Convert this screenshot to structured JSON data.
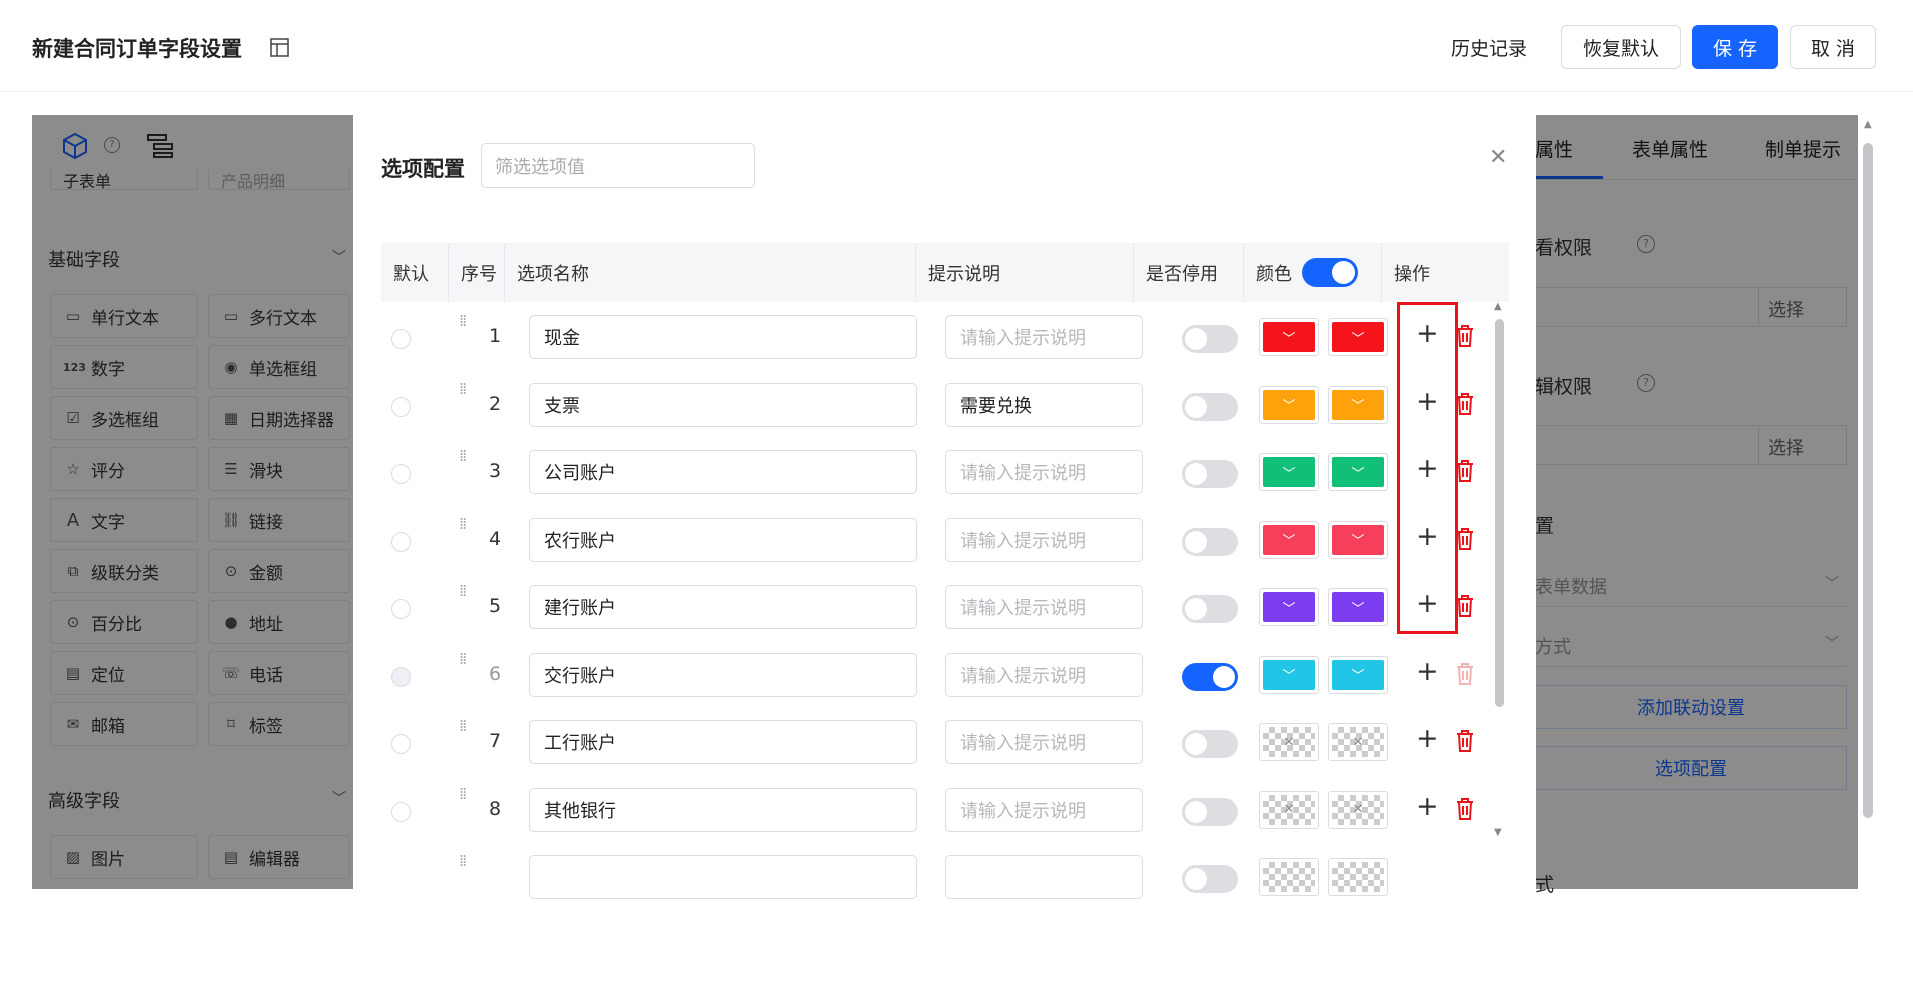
{
  "header": {
    "title": "新建合同订单字段设置",
    "history": "历史记录",
    "restore": "恢复默认",
    "save": "保 存",
    "cancel": "取 消"
  },
  "left_panel": {
    "partial_top": [
      "子表单",
      "产品明细"
    ],
    "basic_title": "基础字段",
    "basic_fields": [
      "单行文本",
      "多行文本",
      "数字",
      "单选框组",
      "多选框组",
      "日期选择器",
      "评分",
      "滑块",
      "文字",
      "链接",
      "级联分类",
      "金额",
      "百分比",
      "地址",
      "定位",
      "电话",
      "邮箱",
      "标签"
    ],
    "advanced_title": "高级字段",
    "advanced_fields": [
      "图片",
      "编辑器"
    ]
  },
  "right_panel": {
    "tabs": [
      "属性",
      "表单属性",
      "制单提示"
    ],
    "view_perm": "看权限",
    "edit_perm": "辑权限",
    "select": "选择",
    "config": "置",
    "form_data": "表单数据",
    "method": "方式",
    "add_linkage": "添加联动设置",
    "option_config": "选项配置",
    "style": "式"
  },
  "modal": {
    "title": "选项配置",
    "filter_placeholder": "筛选选项值",
    "columns": [
      "默认",
      "序号",
      "选项名称",
      "提示说明",
      "是否停用",
      "颜色",
      "操作"
    ],
    "hint_placeholder": "请输入提示说明",
    "rows": [
      {
        "seq": "1",
        "name": "现金",
        "hint": "",
        "disabled": false,
        "color": "#f5141b"
      },
      {
        "seq": "2",
        "name": "支票",
        "hint": "需要兑换",
        "disabled": false,
        "color": "#ffa10a"
      },
      {
        "seq": "3",
        "name": "公司账户",
        "hint": "",
        "disabled": false,
        "color": "#12bf79"
      },
      {
        "seq": "4",
        "name": "农行账户",
        "hint": "",
        "disabled": false,
        "color": "#f53f5b"
      },
      {
        "seq": "5",
        "name": "建行账户",
        "hint": "",
        "disabled": false,
        "color": "#7c3df0"
      },
      {
        "seq": "6",
        "name": "交行账户",
        "hint": "",
        "disabled": true,
        "color": "#21c6e6"
      },
      {
        "seq": "7",
        "name": "工行账户",
        "hint": "",
        "disabled": false,
        "color": ""
      },
      {
        "seq": "8",
        "name": "其他银行",
        "hint": "",
        "disabled": false,
        "color": ""
      }
    ]
  },
  "colors": {
    "primary": "#1664ff",
    "danger": "#e8141b"
  }
}
